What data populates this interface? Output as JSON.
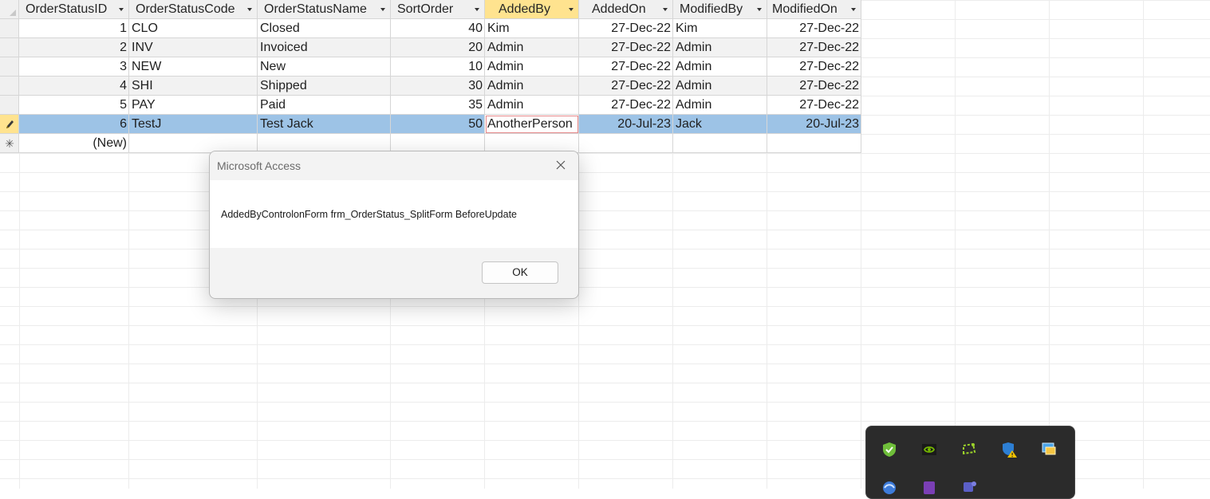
{
  "datasheet": {
    "columns": [
      {
        "label": "OrderStatusID"
      },
      {
        "label": "OrderStatusCode"
      },
      {
        "label": "OrderStatusName"
      },
      {
        "label": "SortOrder"
      },
      {
        "label": "AddedBy"
      },
      {
        "label": "AddedOn"
      },
      {
        "label": "ModifiedBy"
      },
      {
        "label": "ModifiedOn"
      }
    ],
    "rows": [
      {
        "id": "1",
        "code": "CLO",
        "name": "Closed",
        "sort": "40",
        "added_by": "Kim",
        "added_on": "27-Dec-22",
        "modified_by": "Kim",
        "modified_on": "27-Dec-22"
      },
      {
        "id": "2",
        "code": "INV",
        "name": "Invoiced",
        "sort": "20",
        "added_by": "Admin",
        "added_on": "27-Dec-22",
        "modified_by": "Admin",
        "modified_on": "27-Dec-22"
      },
      {
        "id": "3",
        "code": "NEW",
        "name": "New",
        "sort": "10",
        "added_by": "Admin",
        "added_on": "27-Dec-22",
        "modified_by": "Admin",
        "modified_on": "27-Dec-22"
      },
      {
        "id": "4",
        "code": "SHI",
        "name": "Shipped",
        "sort": "30",
        "added_by": "Admin",
        "added_on": "27-Dec-22",
        "modified_by": "Admin",
        "modified_on": "27-Dec-22"
      },
      {
        "id": "5",
        "code": "PAY",
        "name": "Paid",
        "sort": "35",
        "added_by": "Admin",
        "added_on": "27-Dec-22",
        "modified_by": "Admin",
        "modified_on": "27-Dec-22"
      },
      {
        "id": "6",
        "code": "TestJ",
        "name": "Test Jack",
        "sort": "50",
        "added_by": "AnotherPerson",
        "added_on": "20-Jul-23",
        "modified_by": "Jack",
        "modified_on": "20-Jul-23"
      }
    ],
    "new_row_label": "(New)",
    "record_indicators": {
      "editing": "pencil-icon",
      "new": "asterisk-icon"
    }
  },
  "dialog": {
    "title": "Microsoft Access",
    "message": "AddedByControlonForm frm_OrderStatus_SplitForm BeforeUpdate",
    "ok_label": "OK",
    "close_icon": "close-icon"
  },
  "tray_flyout": {
    "icons": [
      "security-check-icon",
      "nvidia-icon",
      "screen-capture-icon",
      "defender-warning-icon",
      "remote-desktop-icon",
      "browser-icon",
      "onenote-icon",
      "teams-icon"
    ]
  },
  "colors": {
    "selected_row": "#9dc3e6",
    "active_header": "#ffe38f",
    "focus_outline": "#e6888a",
    "alt_row": "#f2f2f2"
  }
}
